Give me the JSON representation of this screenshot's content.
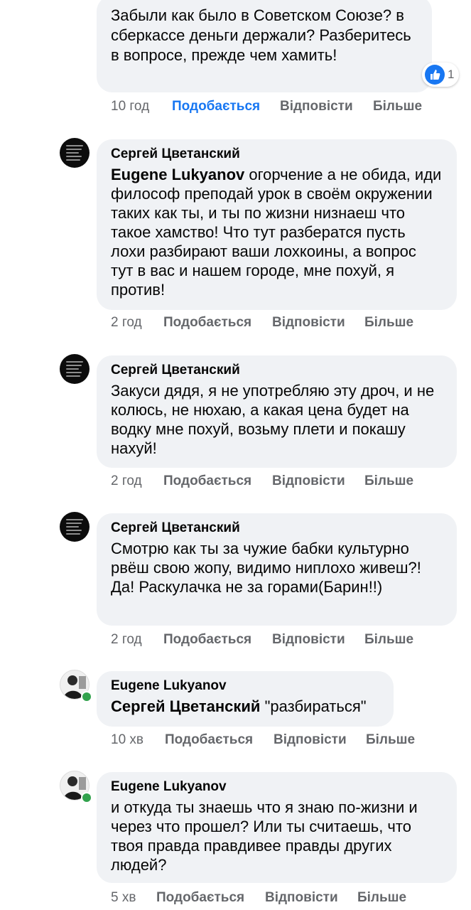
{
  "comments": [
    {
      "author": "",
      "mention": "",
      "text": "Забыли как было в Советском Союзе? в сберкассе деньги держали? Разберитесь в вопросе, прежде чем хамить!",
      "time": "10 год",
      "like_label": "Подобається",
      "reply_label": "Відповісти",
      "more_label": "Більше",
      "reaction_count": "1"
    },
    {
      "author": "Сергей Цветанский",
      "mention": "Eugene Lukyanov",
      "text": " огорчение а не обида, иди философ преподай урок в своём окружении таких как ты, и ты по жизни низнаеш что такое хамство! Что тут разбератся пусть лохи разбирают ваши лохкоины, а вопрос тут в вас и нашем городе, мне похуй, я против!",
      "time": "2 год",
      "like_label": "Подобається",
      "reply_label": "Відповісти",
      "more_label": "Більше"
    },
    {
      "author": "Сергей Цветанский",
      "mention": "",
      "text": "Закуси дядя, я не употребляю эту дроч, и не колюсь, не нюхаю, а какая цена будет на водку мне похуй, возьму плети и покашу нахуй!",
      "time": "2 год",
      "like_label": "Подобається",
      "reply_label": "Відповісти",
      "more_label": "Більше"
    },
    {
      "author": "Сергей Цветанский",
      "mention": "",
      "text": "Смотрю как ты за чужие бабки культурно рвёш свою жопу, видимо ниплохо живеш?! Да! Раскулачка не за горами(Барин!!)",
      "time": "2 год",
      "like_label": "Подобається",
      "reply_label": "Відповісти",
      "more_label": "Більше"
    },
    {
      "author": "Eugene Lukyanov",
      "mention": "Сергей Цветанский",
      "text": " \"разбираться\"",
      "time": "10 хв",
      "like_label": "Подобається",
      "reply_label": "Відповісти",
      "more_label": "Більше"
    },
    {
      "author": "Eugene Lukyanov",
      "mention": "",
      "text": "и откуда ты знаешь что я знаю по-жизни и через что прошел? Или ты считаешь, что твоя правда правдивее правды других людей?",
      "time": "5 хв",
      "like_label": "Подобається",
      "reply_label": "Відповісти",
      "more_label": "Більше"
    }
  ],
  "colors": {
    "bubble": "#f0f2f5",
    "meta": "#65676b",
    "liked": "#1877f2",
    "online": "#31a24c"
  }
}
